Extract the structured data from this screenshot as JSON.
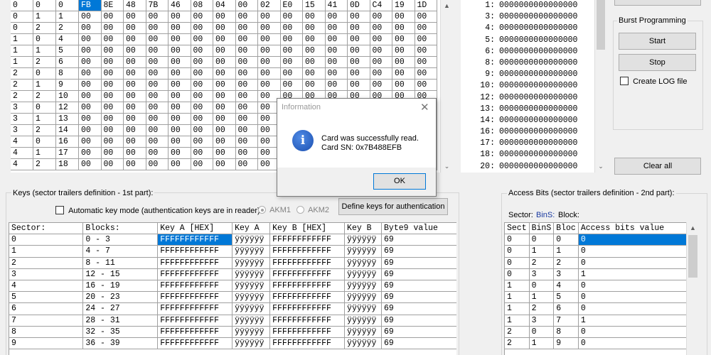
{
  "top_grid": {
    "first_row": [
      "0",
      "0",
      "0",
      "FB",
      "8E",
      "48",
      "7B",
      "46",
      "08",
      "04",
      "00",
      "02",
      "E0",
      "15",
      "41",
      "0D",
      "C4",
      "19",
      "1D"
    ],
    "rows": [
      {
        "s": "0",
        "b": "2",
        "n": "2"
      },
      {
        "s": "1",
        "b": "0",
        "n": "4"
      },
      {
        "s": "1",
        "b": "1",
        "n": "5"
      },
      {
        "s": "1",
        "b": "2",
        "n": "6"
      },
      {
        "s": "2",
        "b": "0",
        "n": "8"
      },
      {
        "s": "2",
        "b": "1",
        "n": "9"
      },
      {
        "s": "2",
        "b": "2",
        "n": "10"
      },
      {
        "s": "3",
        "b": "0",
        "n": "12"
      },
      {
        "s": "3",
        "b": "1",
        "n": "13"
      },
      {
        "s": "3",
        "b": "2",
        "n": "14"
      },
      {
        "s": "4",
        "b": "0",
        "n": "16"
      },
      {
        "s": "4",
        "b": "1",
        "n": "17"
      },
      {
        "s": "4",
        "b": "2",
        "n": "18"
      }
    ],
    "second_row": {
      "s": "0",
      "b": "1",
      "n": "1"
    },
    "hex_value": "00"
  },
  "bit_list": {
    "rows": [
      {
        "n": "1:",
        "v": "0000000000000000"
      },
      {
        "n": "3:",
        "v": "0000000000000000"
      },
      {
        "n": "4:",
        "v": "0000000000000000"
      },
      {
        "n": "5:",
        "v": "0000000000000000"
      },
      {
        "n": "6:",
        "v": "0000000000000000"
      },
      {
        "n": "8:",
        "v": "0000000000000000"
      },
      {
        "n": "9:",
        "v": "0000000000000000"
      },
      {
        "n": "10:",
        "v": "0000000000000000"
      },
      {
        "n": "12:",
        "v": "0000000000000000"
      },
      {
        "n": "13:",
        "v": "0000000000000000"
      },
      {
        "n": "14:",
        "v": "0000000000000000"
      },
      {
        "n": "16:",
        "v": "0000000000000000"
      },
      {
        "n": "17:",
        "v": "0000000000000000"
      },
      {
        "n": "18:",
        "v": "0000000000000000"
      },
      {
        "n": "20:",
        "v": "0000000000000000"
      }
    ]
  },
  "burst": {
    "legend": "Burst Programming",
    "start_label": "Start",
    "stop_label": "Stop",
    "log_label": "Create LOG file",
    "clear_label": "Clear all"
  },
  "dialog": {
    "title": "Information",
    "line1": "Card was successfully read.",
    "line2": "Card SN: 0x7B488EFB",
    "ok_label": "OK"
  },
  "keys": {
    "legend": "Keys (sector trailers definition - 1st part):",
    "auto_label": "Automatic key mode (authentication keys are in reader)",
    "akm1": "AKM1",
    "akm2": "AKM2",
    "define_label": "Define keys for authentication",
    "headers": [
      "Sector:",
      "Blocks:",
      "Key A [HEX]",
      "Key A",
      "Key B [HEX]",
      "Key B",
      "Byte9 value"
    ],
    "rows": [
      [
        "0",
        "0 - 3",
        "FFFFFFFFFFFF",
        "ÿÿÿÿÿÿ",
        "FFFFFFFFFFFF",
        "ÿÿÿÿÿÿ",
        "69"
      ],
      [
        "1",
        "4 - 7",
        "FFFFFFFFFFFF",
        "ÿÿÿÿÿÿ",
        "FFFFFFFFFFFF",
        "ÿÿÿÿÿÿ",
        "69"
      ],
      [
        "2",
        "8 - 11",
        "FFFFFFFFFFFF",
        "ÿÿÿÿÿÿ",
        "FFFFFFFFFFFF",
        "ÿÿÿÿÿÿ",
        "69"
      ],
      [
        "3",
        "12 - 15",
        "FFFFFFFFFFFF",
        "ÿÿÿÿÿÿ",
        "FFFFFFFFFFFF",
        "ÿÿÿÿÿÿ",
        "69"
      ],
      [
        "4",
        "16 - 19",
        "FFFFFFFFFFFF",
        "ÿÿÿÿÿÿ",
        "FFFFFFFFFFFF",
        "ÿÿÿÿÿÿ",
        "69"
      ],
      [
        "5",
        "20 - 23",
        "FFFFFFFFFFFF",
        "ÿÿÿÿÿÿ",
        "FFFFFFFFFFFF",
        "ÿÿÿÿÿÿ",
        "69"
      ],
      [
        "6",
        "24 - 27",
        "FFFFFFFFFFFF",
        "ÿÿÿÿÿÿ",
        "FFFFFFFFFFFF",
        "ÿÿÿÿÿÿ",
        "69"
      ],
      [
        "7",
        "28 - 31",
        "FFFFFFFFFFFF",
        "ÿÿÿÿÿÿ",
        "FFFFFFFFFFFF",
        "ÿÿÿÿÿÿ",
        "69"
      ],
      [
        "8",
        "32 - 35",
        "FFFFFFFFFFFF",
        "ÿÿÿÿÿÿ",
        "FFFFFFFFFFFF",
        "ÿÿÿÿÿÿ",
        "69"
      ],
      [
        "9",
        "36 - 39",
        "FFFFFFFFFFFF",
        "ÿÿÿÿÿÿ",
        "FFFFFFFFFFFF",
        "ÿÿÿÿÿÿ",
        "69"
      ]
    ]
  },
  "access": {
    "legend": "Access Bits (sector trailers definition - 2nd part):",
    "sector_label": "Sector:",
    "bins_label": "BinS:",
    "block_label": "Block:",
    "headers": [
      "Sect",
      "BinS",
      "Bloc",
      "Access bits value"
    ],
    "rows": [
      [
        "0",
        "0",
        "0",
        "0"
      ],
      [
        "0",
        "1",
        "1",
        "0"
      ],
      [
        "0",
        "2",
        "2",
        "0"
      ],
      [
        "0",
        "3",
        "3",
        "1"
      ],
      [
        "1",
        "0",
        "4",
        "0"
      ],
      [
        "1",
        "1",
        "5",
        "0"
      ],
      [
        "1",
        "2",
        "6",
        "0"
      ],
      [
        "1",
        "3",
        "7",
        "1"
      ],
      [
        "2",
        "0",
        "8",
        "0"
      ],
      [
        "2",
        "1",
        "9",
        "0"
      ]
    ]
  },
  "colors": {
    "selection": "#0078d7",
    "window_bg": "#f0f0f0",
    "dialog_icon": "#1b4fb0"
  }
}
